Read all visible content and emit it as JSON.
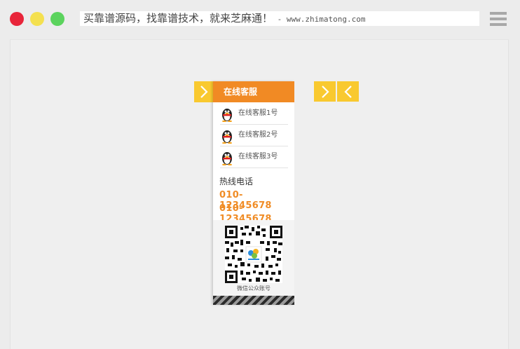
{
  "window": {
    "address_text": "买靠谱源码，找靠谱技术，就来芝麻通！",
    "address_url": " - www.zhimatong.com"
  },
  "panel": {
    "title": "在线客服",
    "qq_items": [
      {
        "label": "在线客服1号"
      },
      {
        "label": "在线客服2号"
      },
      {
        "label": "在线客服3号"
      }
    ],
    "hotline_title": "热线电话",
    "phones": [
      "010-12345678",
      "010-12345678"
    ],
    "qr_caption": "微信公众账号"
  },
  "colors": {
    "header_orange": "#f18a24",
    "tab_yellow": "#f9c92f",
    "phone_orange": "#f08c25"
  }
}
